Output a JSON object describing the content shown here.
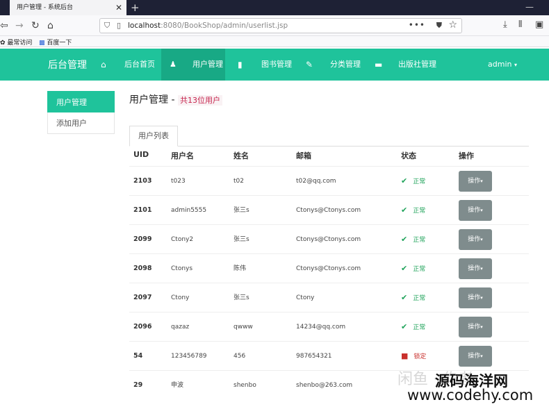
{
  "browser": {
    "tab_title": "用户管理 - 系统后台",
    "tab_close": "✕",
    "new_tab": "+",
    "url_host": "localhost",
    "url_path": ":8080/BookShop/admin/userlist.jsp",
    "bookmarks": [
      {
        "label": "最常访问"
      },
      {
        "label": "百度一下"
      }
    ]
  },
  "app": {
    "brand": "后台管理",
    "menu": [
      {
        "label": "后台首页",
        "icon": "home-icon",
        "active": false
      },
      {
        "label": "用户管理",
        "icon": "user-icon",
        "active": true
      },
      {
        "label": "图书管理",
        "icon": "book-icon",
        "active": false
      },
      {
        "label": "分类管理",
        "icon": "pin-icon",
        "active": false
      },
      {
        "label": "出版社管理",
        "icon": "briefcase-icon",
        "active": false
      }
    ],
    "user_menu": "admin"
  },
  "sidebar": {
    "items": [
      {
        "label": "用户管理",
        "active": true
      },
      {
        "label": "添加用户",
        "active": false
      }
    ]
  },
  "main": {
    "title": "用户管理 -",
    "count_label": "共13位用户",
    "tab": "用户列表",
    "columns": [
      "UID",
      "用户名",
      "姓名",
      "邮箱",
      "状态",
      "操作"
    ],
    "rows": [
      {
        "uid": "2103",
        "username": "t023",
        "name": "t02",
        "email": "t02@qq.com",
        "status": "正常",
        "locked": false,
        "action": "操作"
      },
      {
        "uid": "2101",
        "username": "admin5555",
        "name": "张三s",
        "email": "Ctonys@Ctonys.com",
        "status": "正常",
        "locked": false,
        "action": "操作"
      },
      {
        "uid": "2099",
        "username": "Ctony2",
        "name": "张三s",
        "email": "Ctonys@Ctonys.com",
        "status": "正常",
        "locked": false,
        "action": "操作"
      },
      {
        "uid": "2098",
        "username": "Ctonys",
        "name": "陈伟",
        "email": "Ctonys@Ctonys.com",
        "status": "正常",
        "locked": false,
        "action": "操作"
      },
      {
        "uid": "2097",
        "username": "Ctony",
        "name": "张三s",
        "email": "Ctony",
        "status": "正常",
        "locked": false,
        "action": "操作"
      },
      {
        "uid": "2096",
        "username": "qazaz",
        "name": "qwww",
        "email": "14234@qq.com",
        "status": "正常",
        "locked": false,
        "action": "操作"
      },
      {
        "uid": "54",
        "username": "123456789",
        "name": "456",
        "email": "987654321",
        "status": "锁定",
        "locked": true,
        "action": "操作"
      },
      {
        "uid": "29",
        "username": "申波",
        "name": "shenbo",
        "email": "shenbo@263.com",
        "status": "",
        "locked": false,
        "action": ""
      }
    ]
  },
  "watermark": {
    "faint": "闲鱼 · 作者",
    "line1": "源码海洋网",
    "line2": "www.codehy.com"
  },
  "colors": {
    "accent": "#1fc39b",
    "accent_active": "#18a985",
    "status_ok": "#1fa35a",
    "status_locked": "#c9302c",
    "button_gray": "#7f8c8d"
  }
}
